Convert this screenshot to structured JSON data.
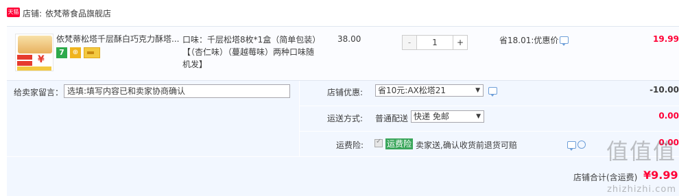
{
  "shop": {
    "badge": "天猫",
    "label": "店铺:",
    "name": "依梵蒂食品旗舰店"
  },
  "item": {
    "title": "依梵蒂松塔千层酥白巧克力酥塔...",
    "spec": "口味：千层松塔8枚*1盒（简单包装）【（杏仁味）（蔓越莓味）两种口味随机发】",
    "unit_price": "38.00",
    "quantity": "1",
    "minus": "-",
    "plus": "+",
    "promo": "省18.01:优惠价",
    "total": "19.99",
    "thumb_yen": "¥",
    "badge_7": "7",
    "badge_shield": "⊕"
  },
  "memo": {
    "label": "给卖家留言：",
    "placeholder": "选填:填写内容已和卖家协商确认"
  },
  "discount": {
    "label": "店铺优惠:",
    "selected": "省10元:AX松塔21",
    "amount": "-10.00"
  },
  "shipping": {
    "label": "运送方式:",
    "method": "普通配送",
    "selected": "快递 免邮",
    "amount": "0.00"
  },
  "insurance": {
    "label": "运费险:",
    "tag": "运费险",
    "text": "卖家送,确认收货前退货可赔",
    "amount": "0.00"
  },
  "summary": {
    "label": "店铺合计(含运费)",
    "value": "¥9.99"
  },
  "watermark": {
    "logo": "值值值",
    "url": "zhizhizhi.com"
  },
  "colors": {
    "price_red": "#ff0036",
    "discount_gray": "#3c3c3c",
    "tag_green": "#3aa65b",
    "panel_blue": "#f2f7ff",
    "row_bg": "#fbfcff"
  }
}
